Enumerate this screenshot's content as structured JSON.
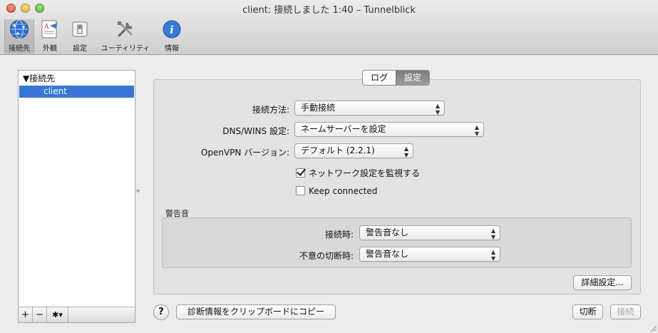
{
  "window": {
    "title": "client: 接続しました 1:40 – Tunnelblick"
  },
  "toolbar": {
    "items": [
      {
        "label": "接続先",
        "icon": "network-globe-icon"
      },
      {
        "label": "外観",
        "icon": "appearance-icon"
      },
      {
        "label": "設定",
        "icon": "switch-settings-icon"
      },
      {
        "label": "ユーティリティ",
        "icon": "tools-icon"
      },
      {
        "label": "情報",
        "icon": "info-icon"
      }
    ],
    "selected": "接続先"
  },
  "sidebar": {
    "header": "▼接続先",
    "items": [
      {
        "label": "client",
        "selected": true
      }
    ],
    "buttons": {
      "add": "+",
      "remove": "−",
      "gear": "✱▾"
    }
  },
  "tabs": {
    "log": "ログ",
    "settings": "設定",
    "active": "設定"
  },
  "settings": {
    "connect_method": {
      "label": "接続方法:",
      "value": "手動接続"
    },
    "dns_wins": {
      "label": "DNS/WINS 設定:",
      "value": "ネームサーバーを設定"
    },
    "openvpn_version": {
      "label": "OpenVPN バージョン:",
      "value": "デフォルト (2.2.1)"
    },
    "monitor_network": {
      "label": "ネットワーク設定を監視する",
      "checked": true
    },
    "keep_connected": {
      "label": "Keep connected",
      "checked": false
    }
  },
  "alert_sound": {
    "group_label": "警告音",
    "on_connect": {
      "label": "接続時:",
      "value": "警告音なし"
    },
    "on_unexpected_disconnect": {
      "label": "不意の切断時:",
      "value": "警告音なし"
    }
  },
  "buttons": {
    "advanced": "詳細設定...",
    "copy_diagnostics": "診断情報をクリップボードにコピー",
    "disconnect": "切断",
    "connect": "接続",
    "help": "?"
  },
  "colors": {
    "selection": "#3776d6",
    "window_bg": "#ececec"
  }
}
